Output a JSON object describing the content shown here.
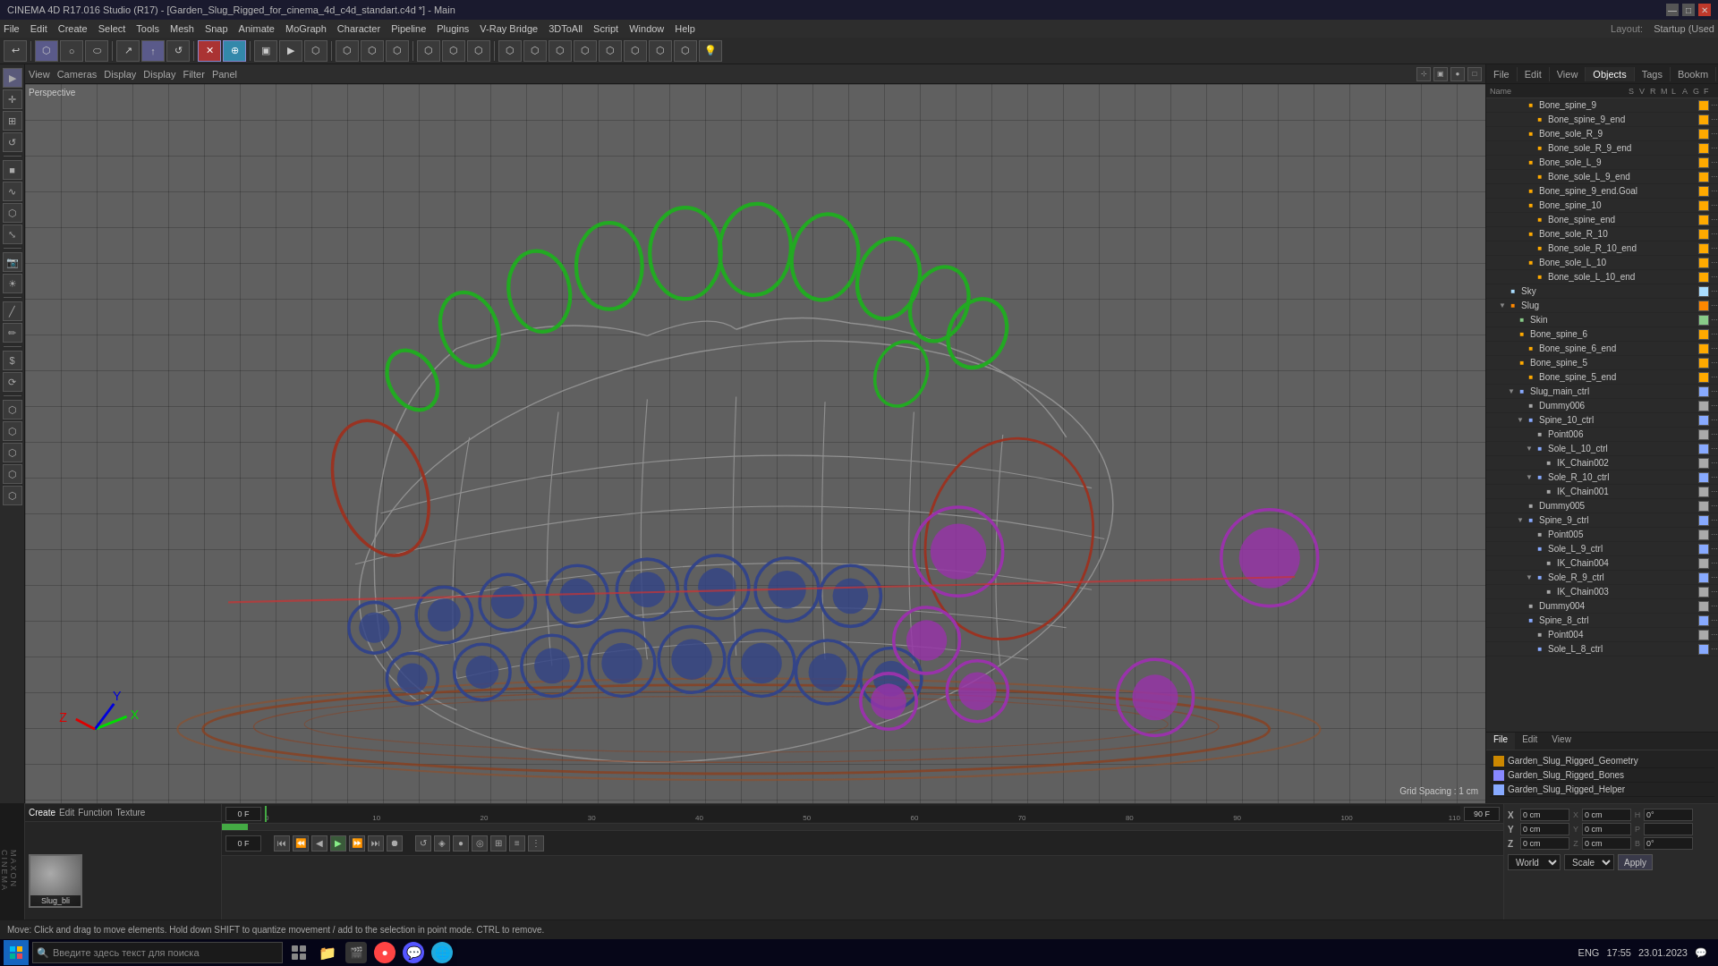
{
  "titleBar": {
    "title": "CINEMA 4D R17.016 Studio (R17) - [Garden_Slug_Rigged_for_cinema_4d_c4d_standart.c4d *] - Main",
    "minimize": "—",
    "maximize": "□",
    "close": "✕"
  },
  "menuBar": {
    "items": [
      "File",
      "Edit",
      "Create",
      "Select",
      "Tools",
      "Mesh",
      "Snap",
      "Animate",
      "MoGraph",
      "Character",
      "Pipeline",
      "Plugins",
      "V-Ray Bridge",
      "3DToAll",
      "Script",
      "Window",
      "Help"
    ]
  },
  "topToolbar": {
    "buttons": [
      "↩",
      "⬡",
      "○",
      "⬭",
      "↗",
      "↑",
      "↺",
      "⬡",
      "✕",
      "⊕",
      "↔",
      "⤢",
      "⟲",
      "▶",
      "⬡",
      "⬡",
      "⬡",
      "⬡",
      "⬡",
      "⬡",
      "⬡",
      "⬡",
      "⬡",
      "⬡",
      "⬡",
      "⬡",
      "⬡",
      "⬡",
      "⬡",
      "⬡",
      "⬡"
    ]
  },
  "viewport": {
    "perspective": "Perspective",
    "tabs": [
      "View",
      "Cameras",
      "Display",
      "Display",
      "Filter",
      "Panel"
    ],
    "gridSpacing": "Grid Spacing : 1 cm",
    "topRightIcons": [
      "⊹",
      "▣",
      "●",
      "□"
    ]
  },
  "rightPanel": {
    "tabs": [
      "File",
      "Edit",
      "View",
      "Objects",
      "Tags",
      "Bookm"
    ],
    "objectTree": [
      {
        "label": "Bone_spine_9",
        "indent": 3,
        "color": "#ffaa00",
        "hasArrow": false
      },
      {
        "label": "Bone_spine_9_end",
        "indent": 4,
        "color": "#ffaa00",
        "hasArrow": false
      },
      {
        "label": "Bone_sole_R_9",
        "indent": 3,
        "color": "#ffaa00",
        "hasArrow": false
      },
      {
        "label": "Bone_sole_R_9_end",
        "indent": 4,
        "color": "#ffaa00",
        "hasArrow": false
      },
      {
        "label": "Bone_sole_L_9",
        "indent": 3,
        "color": "#ffaa00",
        "hasArrow": false
      },
      {
        "label": "Bone_sole_L_9_end",
        "indent": 4,
        "color": "#ffaa00",
        "hasArrow": false
      },
      {
        "label": "Bone_spine_9_end.Goal",
        "indent": 3,
        "color": "#ffaa00",
        "hasArrow": false
      },
      {
        "label": "Bone_spine_10",
        "indent": 3,
        "color": "#ffaa00",
        "hasArrow": false
      },
      {
        "label": "Bone_spine_end",
        "indent": 4,
        "color": "#ffaa00",
        "hasArrow": false
      },
      {
        "label": "Bone_sole_R_10",
        "indent": 3,
        "color": "#ffaa00",
        "hasArrow": false
      },
      {
        "label": "Bone_sole_R_10_end",
        "indent": 4,
        "color": "#ffaa00",
        "hasArrow": false
      },
      {
        "label": "Bone_sole_L_10",
        "indent": 3,
        "color": "#ffaa00",
        "hasArrow": false
      },
      {
        "label": "Bone_sole_L_10_end",
        "indent": 4,
        "color": "#ffaa00",
        "hasArrow": false
      },
      {
        "label": "Sky",
        "indent": 1,
        "color": "#aaddff",
        "hasArrow": false
      },
      {
        "label": "Slug",
        "indent": 1,
        "color": "#ff8800",
        "hasArrow": true,
        "expanded": true
      },
      {
        "label": "Skin",
        "indent": 2,
        "color": "#88cc88",
        "hasArrow": false
      },
      {
        "label": "Bone_spine_6",
        "indent": 2,
        "color": "#ffaa00",
        "hasArrow": false
      },
      {
        "label": "Bone_spine_6_end",
        "indent": 3,
        "color": "#ffaa00",
        "hasArrow": false
      },
      {
        "label": "Bone_spine_5",
        "indent": 2,
        "color": "#ffaa00",
        "hasArrow": false
      },
      {
        "label": "Bone_spine_5_end",
        "indent": 3,
        "color": "#ffaa00",
        "hasArrow": false
      },
      {
        "label": "Slug_main_ctrl",
        "indent": 2,
        "color": "#88aaff",
        "hasArrow": true,
        "expanded": true
      },
      {
        "label": "Dummy006",
        "indent": 3,
        "color": "#aaaaaa",
        "hasArrow": false
      },
      {
        "label": "Spine_10_ctrl",
        "indent": 3,
        "color": "#88aaff",
        "hasArrow": true,
        "expanded": true
      },
      {
        "label": "Point006",
        "indent": 4,
        "color": "#aaaaaa",
        "hasArrow": false
      },
      {
        "label": "Sole_L_10_ctrl",
        "indent": 4,
        "color": "#88aaff",
        "hasArrow": true,
        "expanded": true
      },
      {
        "label": "IK_Chain002",
        "indent": 5,
        "color": "#aaaaaa",
        "hasArrow": false
      },
      {
        "label": "Sole_R_10_ctrl",
        "indent": 4,
        "color": "#88aaff",
        "hasArrow": true,
        "expanded": true
      },
      {
        "label": "IK_Chain001",
        "indent": 5,
        "color": "#aaaaaa",
        "hasArrow": false
      },
      {
        "label": "Dummy005",
        "indent": 3,
        "color": "#aaaaaa",
        "hasArrow": false
      },
      {
        "label": "Spine_9_ctrl",
        "indent": 3,
        "color": "#88aaff",
        "hasArrow": true,
        "expanded": true
      },
      {
        "label": "Point005",
        "indent": 4,
        "color": "#aaaaaa",
        "hasArrow": false
      },
      {
        "label": "Sole_L_9_ctrl",
        "indent": 4,
        "color": "#88aaff",
        "hasArrow": false
      },
      {
        "label": "IK_Chain004",
        "indent": 5,
        "color": "#aaaaaa",
        "hasArrow": false
      },
      {
        "label": "Sole_R_9_ctrl",
        "indent": 4,
        "color": "#88aaff",
        "hasArrow": true,
        "expanded": true
      },
      {
        "label": "IK_Chain003",
        "indent": 5,
        "color": "#aaaaaa",
        "hasArrow": false
      },
      {
        "label": "Dummy004",
        "indent": 3,
        "color": "#aaaaaa",
        "hasArrow": false
      },
      {
        "label": "Spine_8_ctrl",
        "indent": 3,
        "color": "#88aaff",
        "hasArrow": false
      },
      {
        "label": "Point004",
        "indent": 4,
        "color": "#aaaaaa",
        "hasArrow": false
      },
      {
        "label": "Sole_L_8_ctrl",
        "indent": 4,
        "color": "#88aaff",
        "hasArrow": false
      }
    ]
  },
  "bottomPanel": {
    "tabs": [
      "File",
      "Edit",
      "View"
    ],
    "attrTabs": [
      "Name",
      "S",
      "V",
      "R",
      "M",
      "L",
      "A",
      "G",
      "F"
    ],
    "objects": [
      {
        "label": "Garden_Slug_Rigged_Geometry",
        "color": "#cc8800",
        "icon": "■"
      },
      {
        "label": "Garden_Slug_Rigged_Bones",
        "color": "#8888ff",
        "icon": "■"
      },
      {
        "label": "Garden_Slug_Rigged_Helper",
        "color": "#88aaff",
        "icon": "■"
      }
    ]
  },
  "materialEditor": {
    "tabs": [
      "Create",
      "Edit",
      "Function",
      "Texture"
    ],
    "materials": [
      {
        "name": "Slug_bli",
        "color": "#888888"
      }
    ]
  },
  "coordinates": {
    "xVal": "0 cm",
    "xVal2": "0 cm",
    "hVal": "0°",
    "yVal": "0 cm",
    "yVal2": "0 cm",
    "pVal": "",
    "zVal": "0 cm",
    "zVal2": "0 cm",
    "bVal": "0°",
    "xLabel": "X",
    "yLabel": "Y",
    "zLabel": "Z",
    "x2Label": "X",
    "y2Label": "Y",
    "z2Label": "Z",
    "hLabel": "H",
    "pLabel": "P",
    "bLabel": "B",
    "world": "World",
    "scale": "Scale",
    "apply": "Apply"
  },
  "timeline": {
    "startFrame": "0 F",
    "endFrame": "90 F",
    "currentFrame": "0 F",
    "markers": [
      0,
      10,
      20,
      30,
      40,
      50,
      60,
      70,
      80,
      90,
      100,
      110
    ],
    "playbackButtons": [
      "⏮",
      "⏪",
      "◀",
      "▶",
      "⏩",
      "⏭",
      "⏺"
    ]
  },
  "statusBar": {
    "message": "Move: Click and drag to move elements. Hold down SHIFT to quantize movement / add to the selection in point mode. CTRL to remove."
  },
  "taskbar": {
    "searchPlaceholder": "Введите здесь текст для поиска",
    "time": "17:55",
    "date": "23.01.2023",
    "layout": "Layout:",
    "layoutValue": "Startup (Used"
  },
  "leftTools": {
    "tools": [
      "▶",
      "⬡",
      "○",
      "◉",
      "⬡",
      "⟲",
      "⬡",
      "⬡",
      "⬡",
      "⬡",
      "⬡",
      "⬡",
      "⬡",
      "⬡",
      "⬡",
      "⬡",
      "⬡",
      "⬡",
      "⬡",
      "⬡",
      "⬡",
      "⬡"
    ]
  }
}
